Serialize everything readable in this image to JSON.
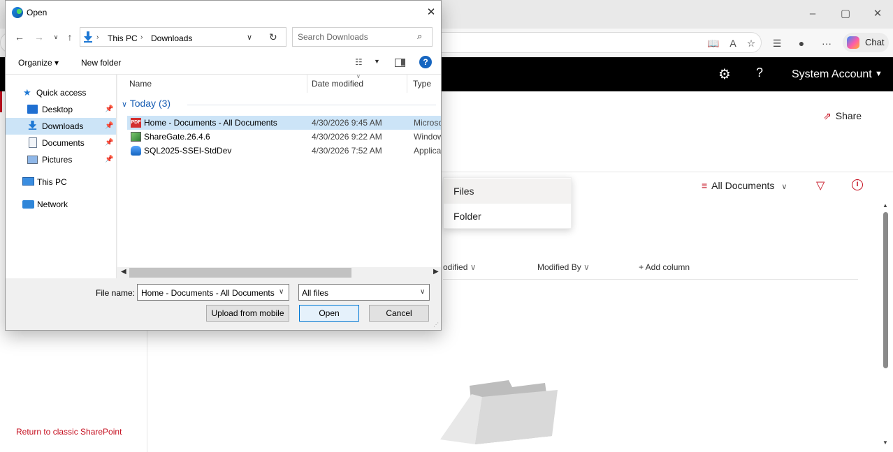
{
  "browser": {
    "window_controls": {
      "minimize": "–",
      "maximize": "▢",
      "close": "✕"
    },
    "toolbar_icons": [
      "read-aloud-icon",
      "favorites-icon",
      "collections-icon",
      "profile-icon",
      "more-icon"
    ],
    "copilot_label": "Chat"
  },
  "sharepoint": {
    "account": "System Account",
    "share_label": "Share",
    "view_label": "All Documents",
    "classic_link": "Return to classic SharePoint",
    "upload_menu": [
      {
        "label": "Files"
      },
      {
        "label": "Folder"
      }
    ],
    "columns": {
      "modified": "odified",
      "modified_by": "Modified By",
      "add_column": "+ Add column"
    },
    "accent_color": "#c50f1f"
  },
  "dialog": {
    "title": "Open",
    "close": "✕",
    "breadcrumb": [
      "This PC",
      "Downloads"
    ],
    "search_placeholder": "Search Downloads",
    "organize": "Organize ▾",
    "new_folder": "New folder",
    "help": "?",
    "nav": {
      "quick_access": "Quick access",
      "items": [
        {
          "label": "Desktop",
          "pinned": true
        },
        {
          "label": "Downloads",
          "pinned": true,
          "selected": true
        },
        {
          "label": "Documents",
          "pinned": true
        },
        {
          "label": "Pictures",
          "pinned": true
        }
      ],
      "this_pc": "This PC",
      "network": "Network"
    },
    "columns": {
      "name": "Name",
      "date": "Date modified",
      "type": "Type"
    },
    "group": "Today (3)",
    "files": [
      {
        "name": "Home - Documents - All Documents",
        "date": "4/30/2026 9:45 AM",
        "type": "Microso",
        "selected": true,
        "icon": "pdf-icon"
      },
      {
        "name": "ShareGate.26.4.6",
        "date": "4/30/2026 9:22 AM",
        "type": "Window",
        "selected": false,
        "icon": "installer-icon"
      },
      {
        "name": "SQL2025-SSEI-StdDev",
        "date": "4/30/2026 7:52 AM",
        "type": "Applicat",
        "selected": false,
        "icon": "sql-icon"
      }
    ],
    "file_name_label": "File name:",
    "file_name_value": "Home - Documents - All Documents",
    "file_type": "All files",
    "buttons": {
      "upload_mobile": "Upload from mobile",
      "open": "Open",
      "cancel": "Cancel"
    }
  }
}
